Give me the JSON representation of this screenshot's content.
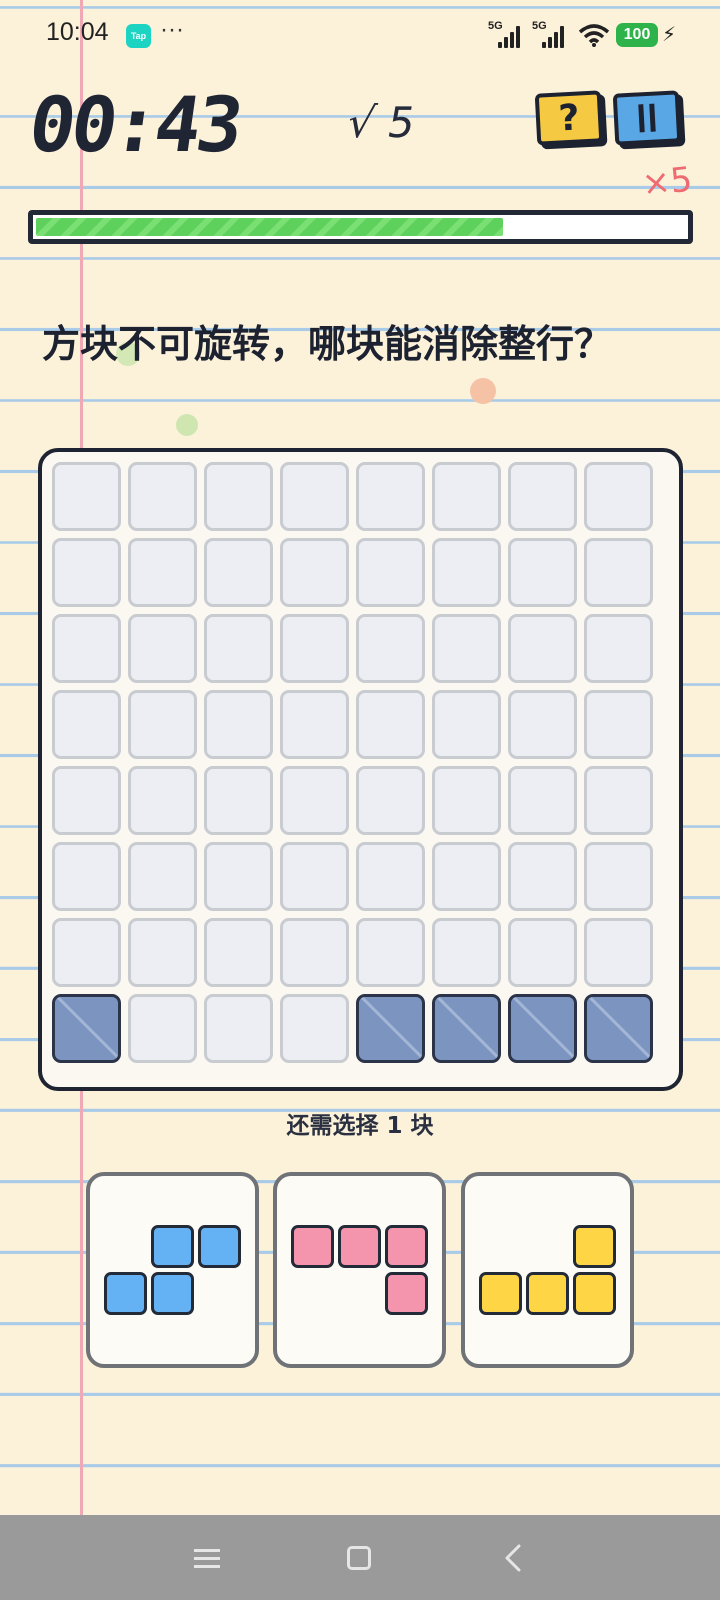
{
  "status_bar": {
    "time": "10:04",
    "app_badge": "Tap",
    "more": "···",
    "signal_1": "5G",
    "signal_2": "5G",
    "battery": "100"
  },
  "header": {
    "timer": "00:43",
    "correct_count": "√ 5",
    "help_label": "?",
    "lives": "×5"
  },
  "progress": {
    "fraction": 0.72
  },
  "question": "方块不可旋转，哪块能消除整行？",
  "board": {
    "rows": 8,
    "cols": 8,
    "filled_cells": [
      [
        7,
        0
      ],
      [
        7,
        4
      ],
      [
        7,
        5
      ],
      [
        7,
        6
      ],
      [
        7,
        7
      ]
    ],
    "empty_color": "#eceef4",
    "filled_color": "#7b94c0"
  },
  "remaining_text": "还需选择 1 块",
  "options": [
    {
      "id": "blue-s",
      "color": "#64b1f4",
      "blocks": [
        [
          0,
          1
        ],
        [
          0,
          2
        ],
        [
          1,
          0
        ],
        [
          1,
          1
        ]
      ]
    },
    {
      "id": "pink-j",
      "color": "#f595ad",
      "blocks": [
        [
          0,
          0
        ],
        [
          0,
          1
        ],
        [
          0,
          2
        ],
        [
          1,
          2
        ]
      ]
    },
    {
      "id": "yellow-l",
      "color": "#fdd545",
      "blocks": [
        [
          0,
          2
        ],
        [
          1,
          0
        ],
        [
          1,
          1
        ],
        [
          1,
          2
        ]
      ]
    }
  ],
  "nav": {
    "icons": [
      "menu-icon",
      "home-icon",
      "back-icon"
    ]
  }
}
